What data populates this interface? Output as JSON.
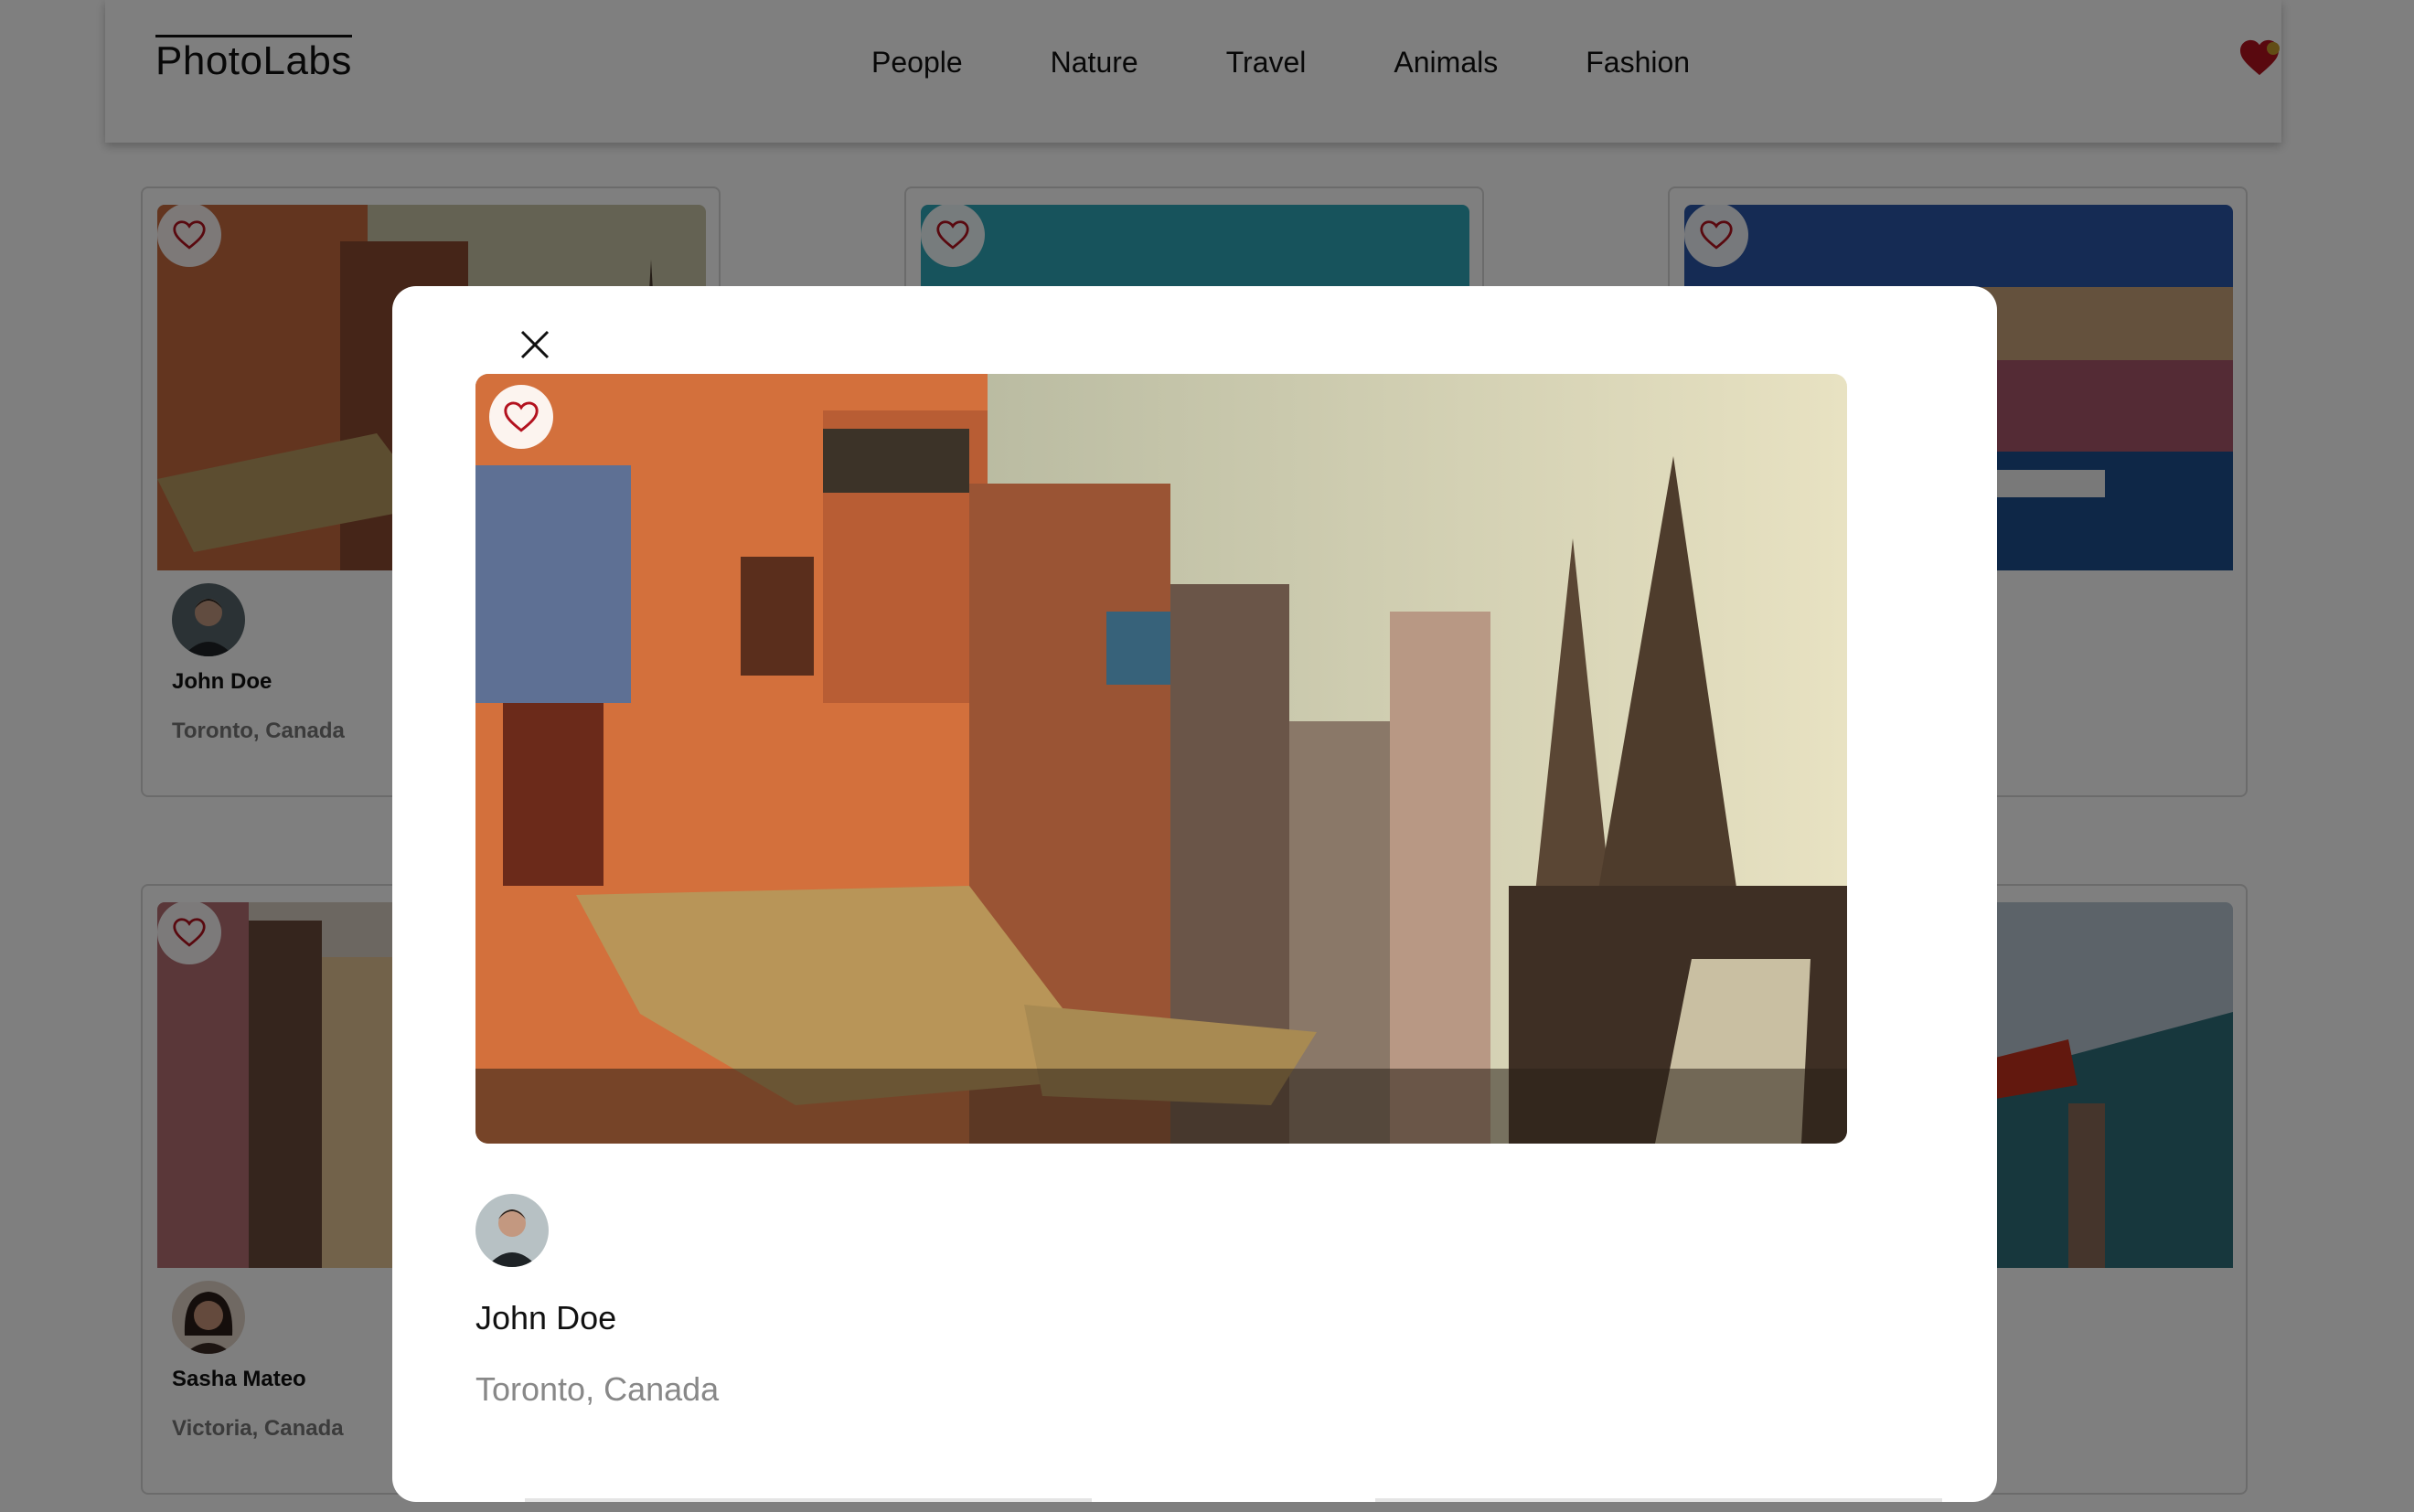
{
  "nav": {
    "logo": "PhotoLabs",
    "topics": [
      "People",
      "Nature",
      "Travel",
      "Animals",
      "Fashion"
    ],
    "fav_icon": "heart-filled-icon",
    "fav_color": "#b3121f",
    "notification_color": "#c49a2a"
  },
  "cards": [
    {
      "name": "John Doe",
      "location": "Toronto, Canada",
      "photo": "varanasi-street-photo",
      "avatar": "john-doe-avatar"
    },
    {
      "name": "",
      "location": "",
      "photo": "turquoise-sky-photo",
      "avatar": ""
    },
    {
      "name": "",
      "location": "",
      "photo": "harbour-town-photo",
      "avatar": ""
    },
    {
      "name": "Sasha Mateo",
      "location": "Victoria, Canada",
      "photo": "colorful-alley-photo",
      "avatar": "sasha-mateo-avatar"
    },
    {
      "name": "",
      "location": "",
      "photo": "",
      "avatar": ""
    },
    {
      "name": "",
      "location": "",
      "photo": "pagoda-roof-photo",
      "avatar": ""
    }
  ],
  "modal": {
    "close_icon": "close-icon",
    "photo": "varanasi-street-photo",
    "fav_icon": "heart-outline-icon",
    "name": "John Doe",
    "location": "Toronto, Canada"
  },
  "colors": {
    "heart_outline": "#b3121f",
    "overlay": "rgba(0,0,0,0.5)"
  }
}
